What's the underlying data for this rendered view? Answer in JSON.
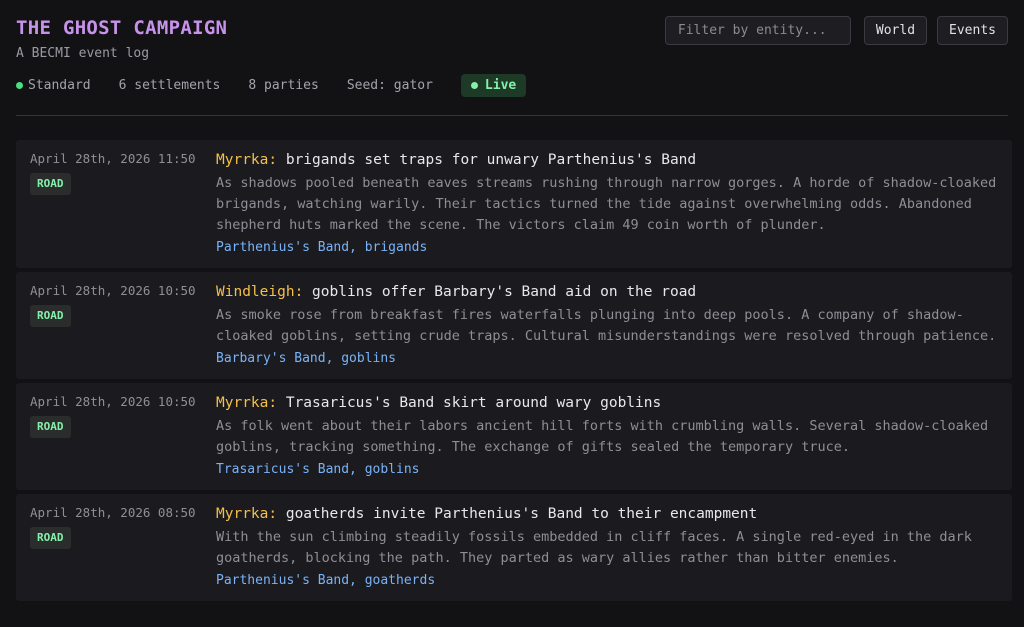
{
  "header": {
    "title": "THE GHOST CAMPAIGN",
    "subtitle": "A BECMI event log",
    "meta": {
      "mode": "Standard",
      "settlements": "6 settlements",
      "parties": "8 parties",
      "seed": "Seed: gator",
      "live": "Live"
    }
  },
  "controls": {
    "filter_placeholder": "Filter by entity...",
    "world_label": "World",
    "events_label": "Events"
  },
  "events": [
    {
      "timestamp": "April 28th, 2026 11:50",
      "badge": "ROAD",
      "place": "Myrrka:",
      "headline": "brigands set traps for unwary Parthenius's Band",
      "description": "As shadows pooled beneath eaves streams rushing through narrow gorges. A horde of shadow-cloaked brigands, watching warily. Their tactics turned the tide against overwhelming odds. Abandoned shepherd huts marked the scene. The victors claim 49 coin worth of plunder.",
      "tags": "Parthenius's Band, brigands"
    },
    {
      "timestamp": "April 28th, 2026 10:50",
      "badge": "ROAD",
      "place": "Windleigh:",
      "headline": "goblins offer Barbary's Band aid on the road",
      "description": "As smoke rose from breakfast fires waterfalls plunging into deep pools. A company of shadow-cloaked goblins, setting crude traps. Cultural misunderstandings were resolved through patience.",
      "tags": "Barbary's Band, goblins"
    },
    {
      "timestamp": "April 28th, 2026 10:50",
      "badge": "ROAD",
      "place": "Myrrka:",
      "headline": "Trasaricus's Band skirt around wary goblins",
      "description": "As folk went about their labors ancient hill forts with crumbling walls. Several shadow-cloaked goblins, tracking something. The exchange of gifts sealed the temporary truce.",
      "tags": "Trasaricus's Band, goblins"
    },
    {
      "timestamp": "April 28th, 2026 08:50",
      "badge": "ROAD",
      "place": "Myrrka:",
      "headline": "goatherds invite Parthenius's Band to their encampment",
      "description": "With the sun climbing steadily fossils embedded in cliff faces. A single red-eyed in the dark goatherds, blocking the path. They parted as wary allies rather than bitter enemies.",
      "tags": "Parthenius's Band, goatherds"
    }
  ],
  "colors": {
    "title": "#c792ea",
    "place": "#f5c04a",
    "tags": "#7ab3f7",
    "badge": "#86efac",
    "live_bg": "#1d3a26"
  }
}
